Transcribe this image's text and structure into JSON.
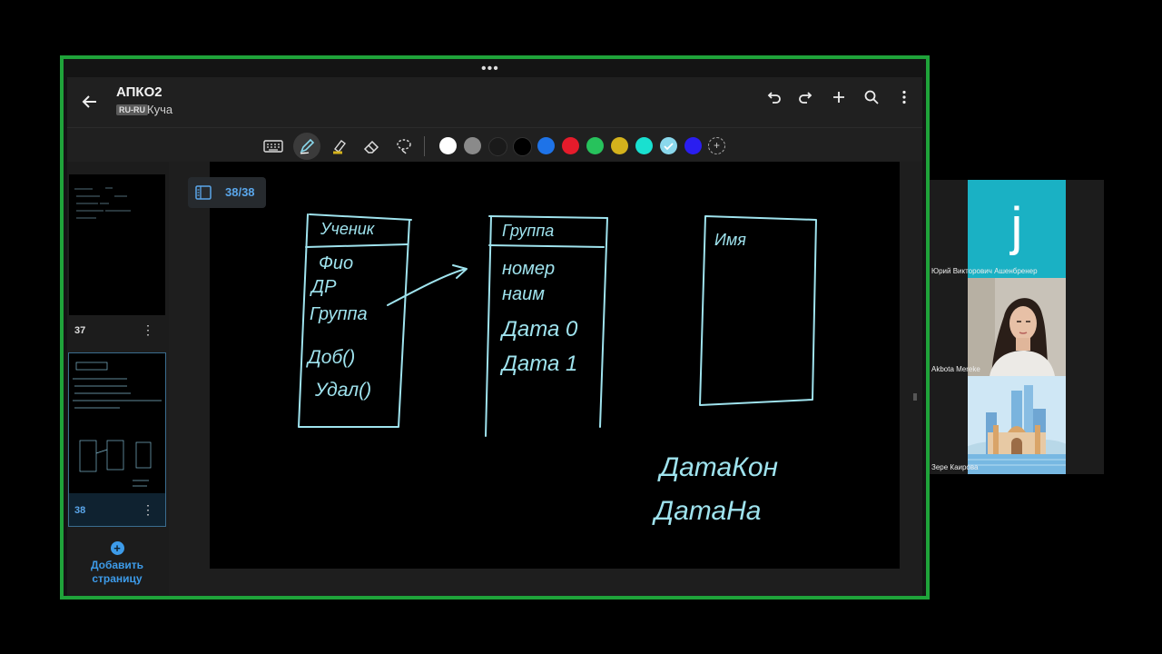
{
  "app": {
    "title": "АПКО2",
    "lang_badge": "RU-RU",
    "subtitle": "Куча"
  },
  "top_actions": [
    "undo-icon",
    "redo-icon",
    "add-icon",
    "search-icon",
    "more-vertical-icon"
  ],
  "tools": [
    "keyboard-icon",
    "pen-icon",
    "highlighter-icon",
    "eraser-icon",
    "lasso-icon"
  ],
  "colors": [
    "#ffffff",
    "#8a8a8a",
    "#1a1a1a",
    "#000000",
    "#1e73e8",
    "#e51b2b",
    "#27c25c",
    "#d4b21c",
    "#19e0d0",
    "#8ad8ec",
    "#2a1ef0"
  ],
  "selected_color": "#8ad8ec",
  "sidebar": {
    "pages": [
      {
        "number": "37",
        "menu": "⋮"
      },
      {
        "number": "38",
        "menu": "⋮"
      }
    ],
    "add_page_line1": "Добавить",
    "add_page_line2": "страницу"
  },
  "page_counter": "38/38",
  "participants": [
    {
      "name": "Юрий Викторович Ашенбренер",
      "avatar_letter": "j"
    },
    {
      "name": "Akbota Mereke"
    },
    {
      "name": "Зере Каирова"
    }
  ],
  "ink": {
    "table1": {
      "title": "Ученик",
      "fields": [
        "Фио",
        "ДР",
        "Группа",
        "Доб()",
        "Удал()"
      ]
    },
    "table2": {
      "title": "Группа",
      "fields": [
        "номер",
        "наим",
        "Дата 0",
        "Дата 1"
      ]
    },
    "table3": {
      "fields": [
        "Имя"
      ]
    },
    "notes": [
      "ДатаКон",
      "ДатаНа"
    ]
  },
  "accent_color": "#1fa33a"
}
